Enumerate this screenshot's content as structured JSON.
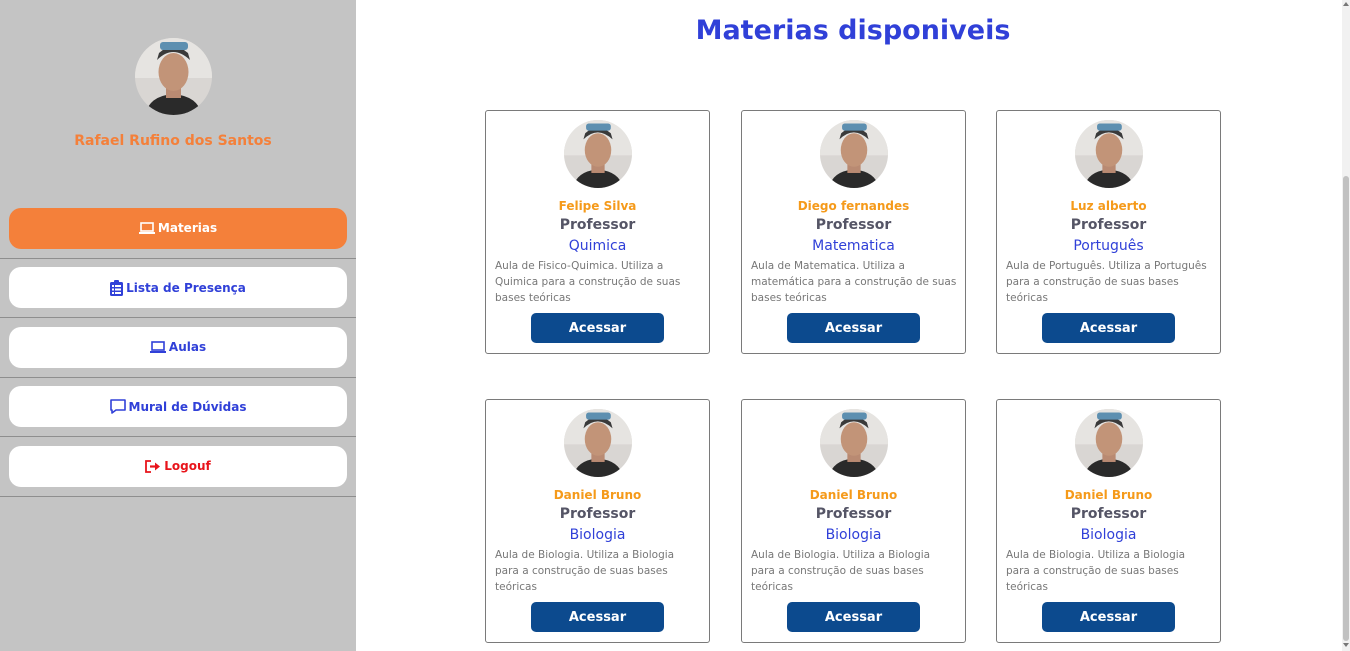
{
  "user": {
    "name": "Rafael Rufino dos Santos"
  },
  "nav": [
    {
      "label": "Materias",
      "icon": "laptop-icon",
      "active": true
    },
    {
      "label": "Lista de Presença",
      "icon": "clipboard-list-icon"
    },
    {
      "label": "Aulas",
      "icon": "laptop-icon"
    },
    {
      "label": "Mural de Dúvidas",
      "icon": "message-icon"
    },
    {
      "label": "Logouf",
      "icon": "sign-out-icon"
    }
  ],
  "page": {
    "title": "Materias disponiveis"
  },
  "cards": [
    {
      "name": "Felipe Silva",
      "role": "Professor",
      "subject": "Quimica",
      "description": "Aula de Fisico-Quimica. Utiliza a Quimica para a construção de suas bases teóricas",
      "button": "Acessar"
    },
    {
      "name": "Diego fernandes",
      "role": "Professor",
      "subject": "Matematica",
      "description": "Aula de Matematica. Utiliza a matemática para a construção de suas bases teóricas",
      "button": "Acessar"
    },
    {
      "name": "Luz alberto",
      "role": "Professor",
      "subject": "Português",
      "description": "Aula de Português. Utiliza a Português para a construção de suas bases teóricas",
      "button": "Acessar"
    },
    {
      "name": "Daniel Bruno",
      "role": "Professor",
      "subject": "Biologia",
      "description": "Aula de Biologia. Utiliza a Biologia para a construção de suas bases teóricas",
      "button": "Acessar"
    },
    {
      "name": "Daniel Bruno",
      "role": "Professor",
      "subject": "Biologia",
      "description": "Aula de Biologia. Utiliza a Biologia para a construção de suas bases teóricas",
      "button": "Acessar"
    },
    {
      "name": "Daniel Bruno",
      "role": "Professor",
      "subject": "Biologia",
      "description": "Aula de Biologia. Utiliza a Biologia para a construção de suas bases teóricas",
      "button": "Acessar"
    }
  ],
  "colors": {
    "accent": "#f4803a",
    "primary": "#3040d8",
    "button": "#0c4a8e",
    "logout": "#e8141b",
    "sidebar": "#c4c4c4"
  }
}
